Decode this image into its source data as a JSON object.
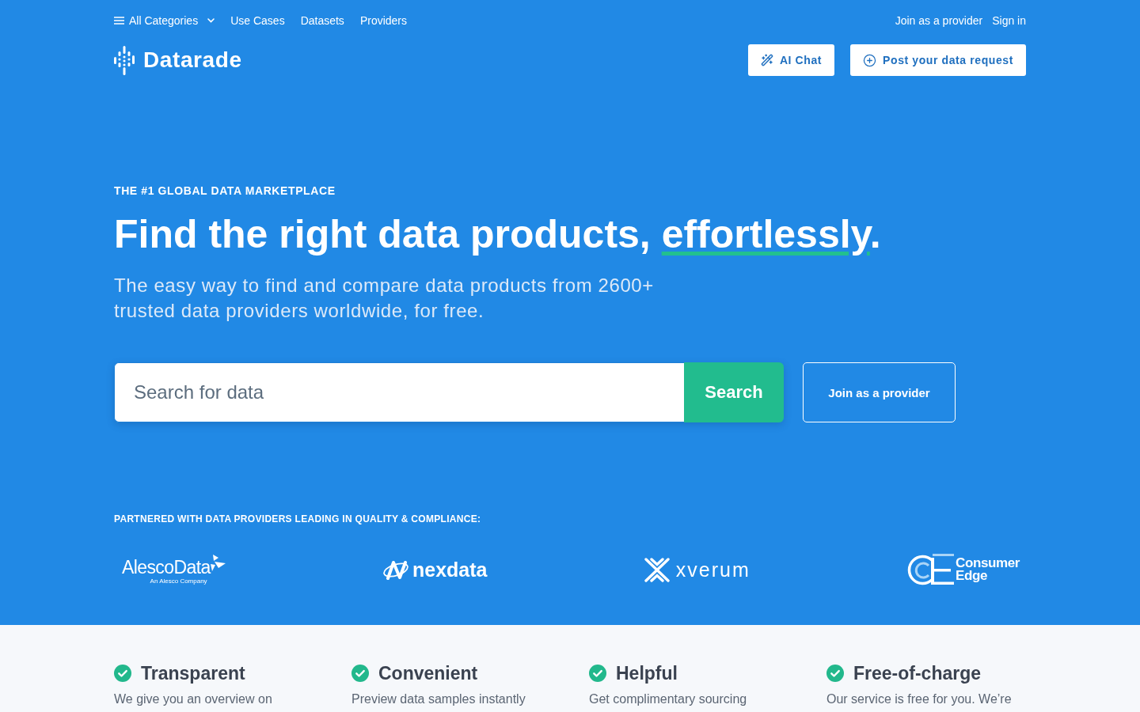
{
  "top_nav": {
    "links": [
      {
        "label": "All Categories",
        "kind": "menu"
      },
      {
        "label": "Use Cases",
        "kind": "link"
      },
      {
        "label": "Datasets",
        "kind": "link"
      },
      {
        "label": "Providers",
        "kind": "link"
      }
    ],
    "account_links": [
      "Join as a provider",
      "Sign in"
    ]
  },
  "header": {
    "brand": "Datarade",
    "buttons": [
      {
        "label": "AI Chat",
        "kind": "ai"
      },
      {
        "label": "Post your data request",
        "kind": "add"
      }
    ]
  },
  "hero": {
    "eyebrow": "THE #1 GLOBAL DATA MARKETPLACE",
    "headline": {
      "text": "Find the right data products, ",
      "underlined": "effortlessly",
      "end": "."
    },
    "subtitle": "The easy way to find and compare data products from 2600+ trusted data providers worldwide, for free.",
    "search": {
      "placeholder": "Search for data",
      "button": "Search"
    },
    "secondary_button": "Join as a provider"
  },
  "partners": {
    "label": "PARTNERED WITH DATA PROVIDERS LEADING IN QUALITY & COMPLIANCE:",
    "logos": [
      {
        "kind": "alesco",
        "name": "AlescoData",
        "tagline": "An Alesco Company"
      },
      {
        "kind": "nexdata",
        "name": "nexdata"
      },
      {
        "kind": "xverum",
        "name": "xverum"
      },
      {
        "kind": "consumer_edge",
        "name": "Consumer Edge"
      }
    ]
  },
  "features": [
    {
      "title": "Transparent",
      "text": "We give you an overview on"
    },
    {
      "title": "Convenient",
      "text": "Preview data samples instantly"
    },
    {
      "title": "Helpful",
      "text": "Get complimentary sourcing"
    },
    {
      "title": "Free-of-charge",
      "text": "Our service is free for you. We’re"
    }
  ]
}
